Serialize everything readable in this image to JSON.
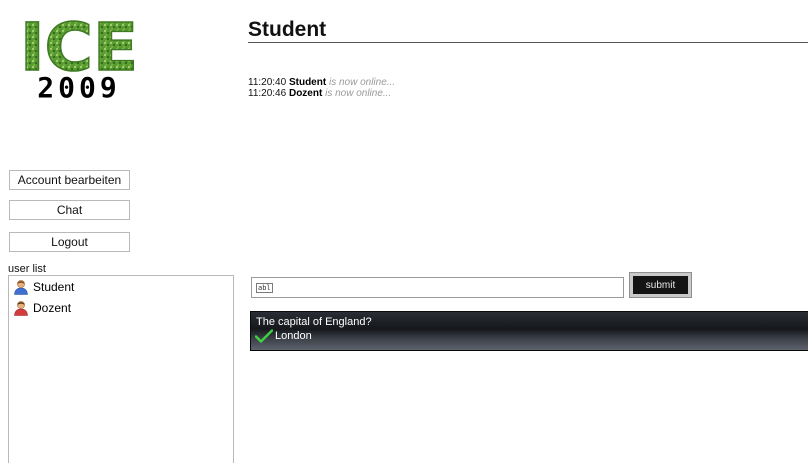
{
  "logo": {
    "top_text": "ICE",
    "bottom_text": "2009"
  },
  "page": {
    "title": "Student"
  },
  "chat": {
    "messages": [
      {
        "time": "11:20:40",
        "user": "Student",
        "status": "is now online..."
      },
      {
        "time": "11:20:46",
        "user": "Dozent",
        "status": "is now online..."
      }
    ]
  },
  "sidebar": {
    "buttons": {
      "account": "Account bearbeiten",
      "chat": "Chat",
      "logout": "Logout"
    },
    "user_list_label": "user list",
    "users": [
      {
        "name": "Student",
        "icon": "user-student-icon"
      },
      {
        "name": "Dozent",
        "icon": "user-dozent-icon"
      }
    ]
  },
  "input": {
    "value": "",
    "submit_label": "submit"
  },
  "question": {
    "text": "The capital of England?",
    "answer": "London"
  },
  "colors": {
    "logo_green": "#4f8f2a",
    "panel_dark": "#15171b",
    "answer_check": "#3fd13f"
  }
}
